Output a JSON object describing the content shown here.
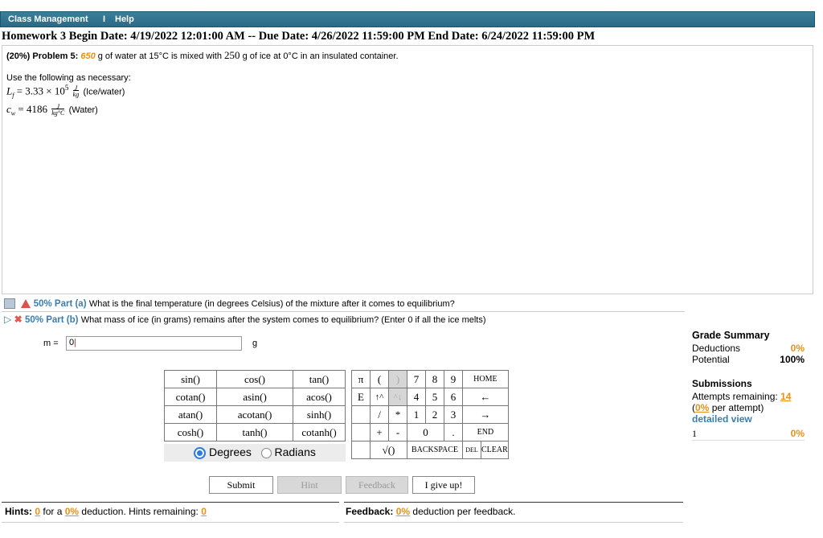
{
  "menu": {
    "class_management": "Class Management",
    "separator": "I",
    "help": "Help"
  },
  "header": {
    "dates": "Homework 3 Begin Date: 4/19/2022 12:01:00 AM -- Due Date: 4/26/2022 11:59:00 PM End Date: 6/24/2022 11:59:00 PM"
  },
  "problem": {
    "weight": "(20%)",
    "label": "Problem 5:",
    "mass_water": "650",
    "text_a": "g of water at 15°C is mixed with",
    "mass_ice": "250",
    "text_b": "g of ice at 0°C in an insulated container.",
    "use_following": "Use the following as necessary:",
    "lf": "L",
    "lf_sub": "f",
    "lf_value": "= 3.33 × 10",
    "lf_exp": "5",
    "lf_unit_num": "J",
    "lf_unit_den": "kg",
    "lf_note": "(Ice/water)",
    "cw": "c",
    "cw_sub": "w",
    "cw_value": "= 4186",
    "cw_unit_num": "J",
    "cw_unit_den": "kg°C",
    "cw_note": "(Water)"
  },
  "parts": [
    {
      "weight": "50% Part (a)",
      "question": "What is the final temperature (in degrees Celsius) of the mixture after it comes to equilibrium?"
    },
    {
      "weight": "50% Part (b)",
      "question": "What mass of ice (in grams) remains after the system comes to equilibrium? (Enter 0 if all the ice melts)"
    }
  ],
  "answer": {
    "var_label": "m =",
    "value": "0",
    "unit": "g"
  },
  "functions": [
    [
      "sin()",
      "cos()",
      "tan()"
    ],
    [
      "cotan()",
      "asin()",
      "acos()"
    ],
    [
      "atan()",
      "acotan()",
      "sinh()"
    ],
    [
      "cosh()",
      "tanh()",
      "cotanh()"
    ]
  ],
  "angle_mode": {
    "degrees": "Degrees",
    "radians": "Radians",
    "selected": "Degrees"
  },
  "keypad": {
    "pi": "π",
    "lparen": "(",
    "rparen": ")",
    "e": "E",
    "up": "↑^",
    "down": "^↓",
    "slash": "/",
    "star": "*",
    "plus": "+",
    "minus": "-",
    "sqrt": "√()",
    "d7": "7",
    "d8": "8",
    "d9": "9",
    "d4": "4",
    "d5": "5",
    "d6": "6",
    "d1": "1",
    "d2": "2",
    "d3": "3",
    "d0": "0",
    "dot": ".",
    "home": "HOME",
    "left": "←",
    "right": "→",
    "end": "END",
    "backspace": "BACKSPACE",
    "del": "DEL",
    "clear": "CLEAR"
  },
  "buttons": {
    "submit": "Submit",
    "hint": "Hint",
    "feedback": "Feedback",
    "give_up": "I give up!"
  },
  "hints": {
    "label": "Hints:",
    "count": "0",
    "for_a": "for a",
    "pct": "0%",
    "text": "deduction. Hints remaining:",
    "remaining": "0"
  },
  "feedback": {
    "label": "Feedback:",
    "pct": "0%",
    "text": "deduction per feedback."
  },
  "grade": {
    "title": "Grade Summary",
    "deductions_label": "Deductions",
    "deductions": "0%",
    "potential_label": "Potential",
    "potential": "100%",
    "submissions_title": "Submissions",
    "attempts_label": "Attempts remaining:",
    "attempts": "14",
    "per_attempt_pct": "0%",
    "per_attempt_text": "per attempt)",
    "detailed_view": "detailed view",
    "row_num": "1",
    "row_pct": "0%"
  }
}
